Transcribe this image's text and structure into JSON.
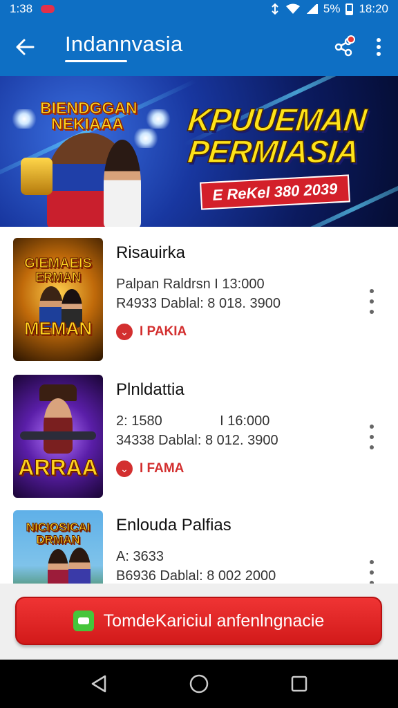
{
  "status_bar": {
    "time_left": "1:38",
    "battery": "5%",
    "time_right": "18:20"
  },
  "app_bar": {
    "title": "Indannvasia",
    "back_icon": "back-arrow-icon",
    "share_icon": "share-icon",
    "more_icon": "more-vertical-icon"
  },
  "banner": {
    "logo_line1": "BIENDGGAN",
    "logo_line2": "NEKIAAA",
    "headline_line1": "KPUUEMAN",
    "headline_line2": "PERMIASIA",
    "tag": "E ReKel 380 2039"
  },
  "items": [
    {
      "thumb_title_top": "GIEMAEIS",
      "thumb_title_mid": "ERMAN",
      "thumb_title_bottom": "MEMAN",
      "title": "Risauirka",
      "line1": "Palpan Raldrsn  I 13:000",
      "line2": "R4933 Dablal:  8  018. 3900",
      "badge": "I PAKIA"
    },
    {
      "thumb_title_top": "",
      "thumb_title_mid": "",
      "thumb_title_bottom": "ARRAA",
      "title": "Plnldattia",
      "line1": "2: 1580               I 16:000",
      "line2": "34338 Dablal:  8  012. 3900",
      "badge": "I FAMA"
    },
    {
      "thumb_title_top": "NICIOSICAI",
      "thumb_title_mid": "DRMAN",
      "thumb_title_bottom": "",
      "title": "Enlouda Palfias",
      "line1": "A: 3633",
      "line2": "B6936 Dablal:  8  002 2000",
      "badge": ""
    }
  ],
  "cta": {
    "label": "TomdeKariciul anfenlngnacie",
    "icon": "chat-icon"
  },
  "colors": {
    "primary": "#0e6fc4",
    "accent": "#d32f2f",
    "cta": "#e02424"
  }
}
